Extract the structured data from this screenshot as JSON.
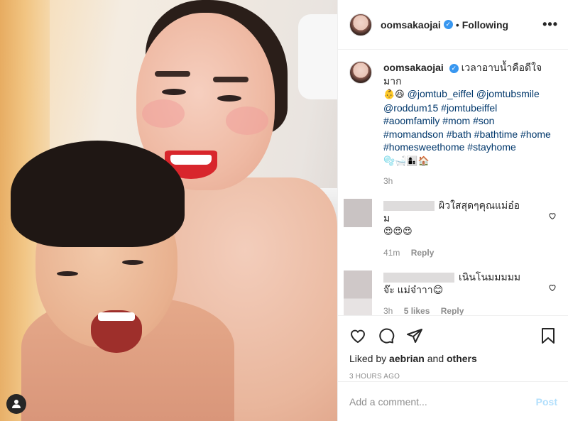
{
  "header": {
    "username": "oomsakaojai",
    "separator": "•",
    "follow_status": "Following",
    "more_label": "•••"
  },
  "caption": {
    "username": "oomsakaojai",
    "text": "เวลาอาบน้ำคือดีใจมาก",
    "emoji_line1": "👶😆",
    "mention1": "@jomtub_eiffel",
    "mention2": "@jomtubsmile",
    "mention3": "@roddum15",
    "tag1": "#jomtubeiffel",
    "tag2": "#aoomfamily",
    "tag3": "#mom",
    "tag4": "#son",
    "tag5": "#momandson",
    "tag6": "#bath",
    "tag7": "#bathtime",
    "tag8": "#home",
    "tag9": "#homesweethome",
    "tag10": "#stayhome",
    "emoji_line2": "🫧🛁👩‍👦🏠",
    "time": "3h"
  },
  "comments": [
    {
      "text": "ผิวใสสุดๆคุณแม่อ๋อม",
      "emoji": "😍😍😍",
      "time": "41m",
      "reply": "Reply"
    },
    {
      "text": "เนินโนมมมมมจ๊ะ แม่จ๋าาา😊",
      "time": "3h",
      "likes": "5 likes",
      "reply": "Reply"
    }
  ],
  "likes": {
    "prefix": "Liked by",
    "user": "aebrian",
    "and": "and",
    "others": "others"
  },
  "posted_ago": "3 HOURS AGO",
  "add_comment": {
    "placeholder": "Add a comment...",
    "post_label": "Post"
  },
  "colors": {
    "link": "#00376b",
    "verified": "#3897f0",
    "post_disabled": "#b2dffc",
    "muted": "#8e8e8e"
  }
}
